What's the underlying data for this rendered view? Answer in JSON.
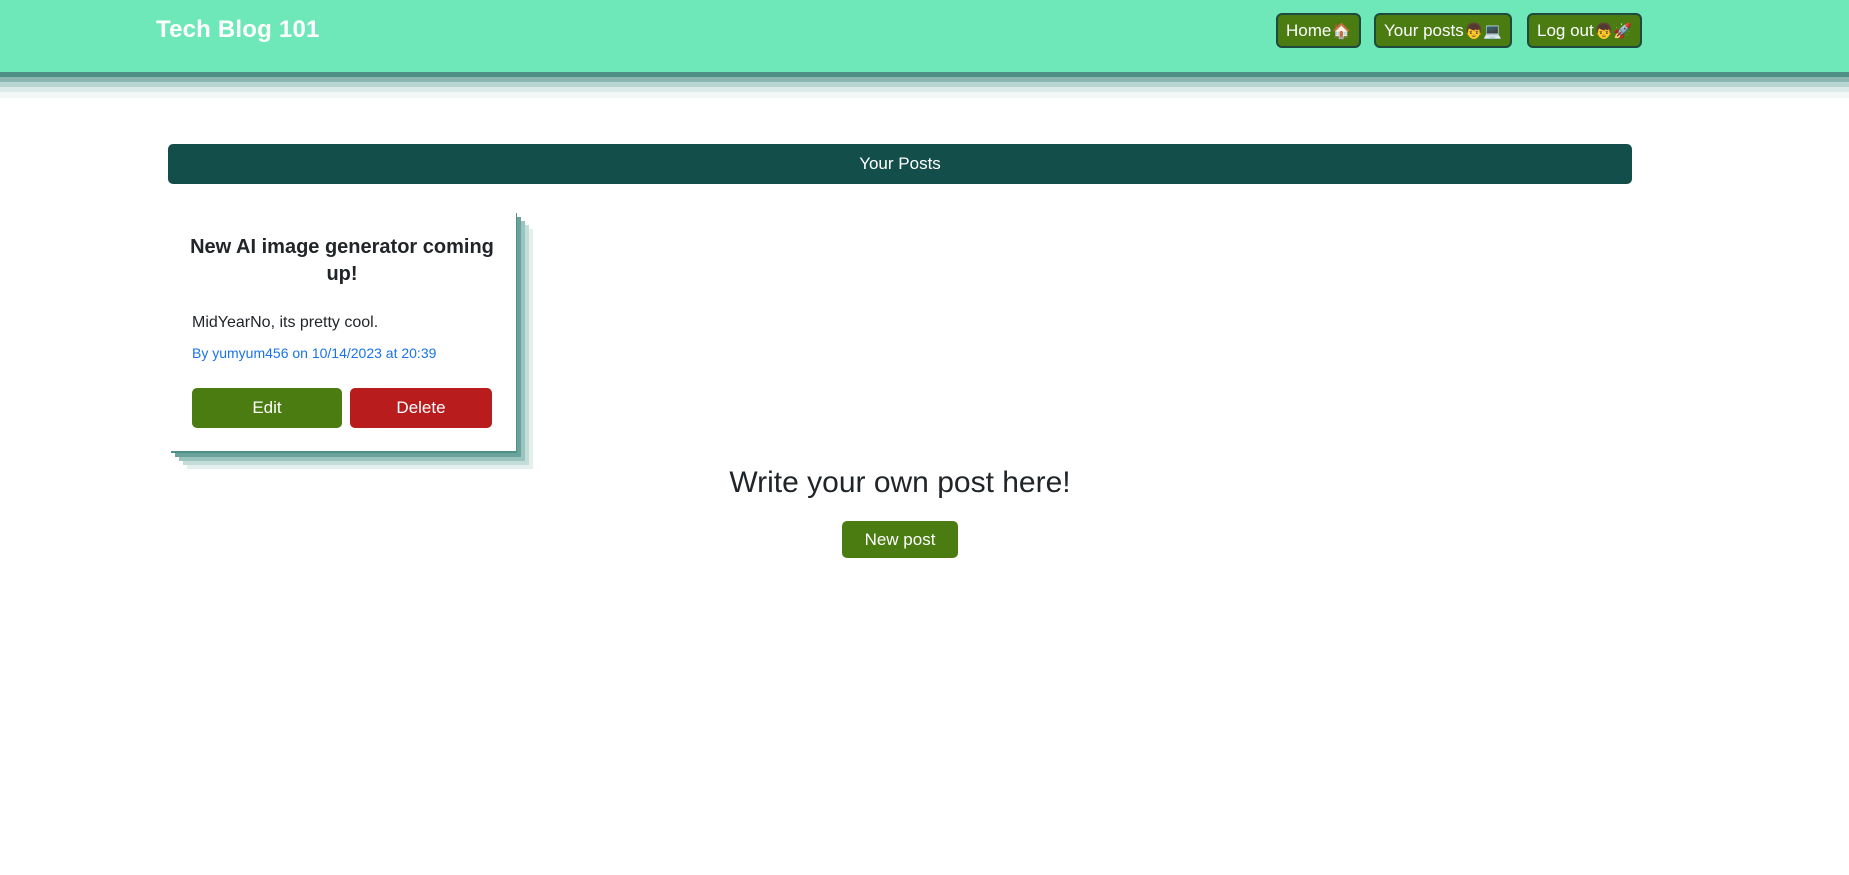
{
  "brand": {
    "title": "Tech Blog 101"
  },
  "nav": {
    "home_label": "Home",
    "home_emoji": "🏠",
    "your_posts_label": "Your posts",
    "your_posts_emoji": "👦💻",
    "logout_label": "Log out",
    "logout_emoji": "👦🚀"
  },
  "section": {
    "title": "Your Posts"
  },
  "posts": [
    {
      "title": "New AI image generator coming up!",
      "body": "MidYearNo, its pretty cool.",
      "meta": "By yumyum456 on 10/14/2023 at 20:39",
      "edit_label": "Edit",
      "delete_label": "Delete"
    }
  ],
  "cta": {
    "heading": "Write your own post here!",
    "button_label": "New post"
  },
  "colors": {
    "navbar": "#6ee8b8",
    "section_header": "#134e4a",
    "primary_button": "#4a7c12",
    "danger_button": "#b91c1c",
    "meta_text": "#1a73e8"
  },
  "icons": {
    "home": "house-icon",
    "your_posts": "person-laptop-icon",
    "logout": "person-rocket-icon"
  }
}
